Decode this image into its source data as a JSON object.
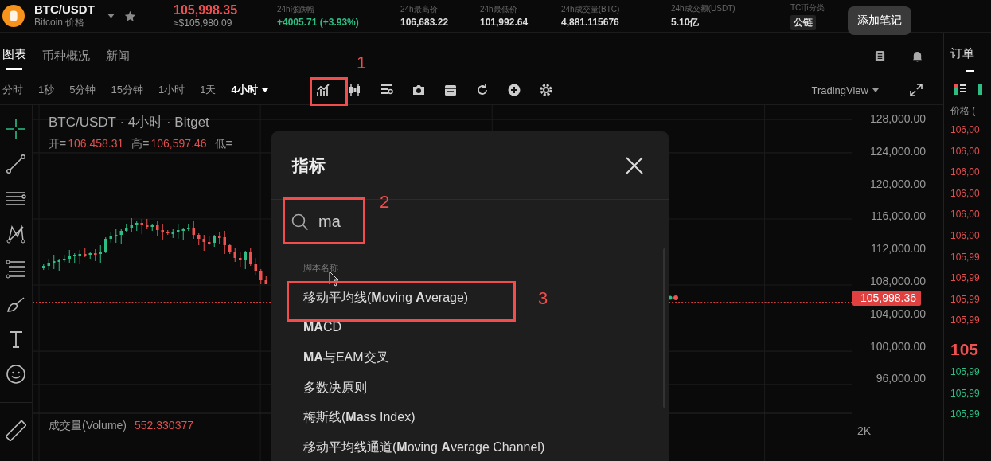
{
  "header": {
    "pair": "BTC/USDT",
    "subtitle": "Bitcoin 价格",
    "price": "105,998.35",
    "price_usd": "≈$105,980.09",
    "stats": [
      {
        "label": "24h涨跌幅",
        "value": "+4005.71 (+3.93%)",
        "kind": "up"
      },
      {
        "label": "24h最高价",
        "value": "106,683.22",
        "kind": "plain"
      },
      {
        "label": "24h最低价",
        "value": "101,992.64",
        "kind": "plain"
      },
      {
        "label": "24h成交量(BTC)",
        "value": "4,881.115676",
        "kind": "plain"
      },
      {
        "label": "24h成交额(USDT)",
        "value": "5.10亿",
        "kind": "plain"
      },
      {
        "label": "TC币分类",
        "value": "公链",
        "kind": "tag"
      }
    ]
  },
  "tooltip": "添加笔记",
  "tabs": [
    {
      "label": "图表",
      "selected": true
    },
    {
      "label": "币种概况",
      "selected": false
    },
    {
      "label": "新闻",
      "selected": false
    }
  ],
  "intervals": [
    {
      "label": "分时",
      "selected": false
    },
    {
      "label": "1秒",
      "selected": false
    },
    {
      "label": "5分钟",
      "selected": false
    },
    {
      "label": "15分钟",
      "selected": false
    },
    {
      "label": "1小时",
      "selected": false
    },
    {
      "label": "1天",
      "selected": false
    },
    {
      "label": "4小时",
      "selected": true
    }
  ],
  "chart_source": "TradingView",
  "chart": {
    "title": "BTC/USDT · 4小时 · Bitget",
    "ohlc": [
      {
        "label": "开=",
        "value": "106,458.31"
      },
      {
        "label": "高=",
        "value": "106,597.46"
      }
    ],
    "ohlc_more": "低=",
    "price_ticks": [
      "128,000.00",
      "124,000.00",
      "120,000.00",
      "116,000.00",
      "112,000.00",
      "108,000.00",
      "104,000.00",
      "100,000.00",
      "96,000.00"
    ],
    "current_price": "105,998.36",
    "volume_label": "成交量(Volume)",
    "volume_value": "552.330377",
    "volume_tick": "2K"
  },
  "dialog": {
    "title": "指标",
    "search": {
      "value": "ma"
    },
    "section": "脚本名称",
    "results": [
      "移动平均线(**M**oving **A**verage)",
      "**MA**CD",
      "**MA**与EAM交叉",
      "多数决原则",
      "梅斯线(**Ma**ss Index)",
      "移动平均线通道(**M**oving **A**verage Channel)"
    ]
  },
  "order_book": {
    "title": "订单",
    "header": "价格 (",
    "asks": [
      {
        "price": "106,00",
        "color": "#e0504f"
      },
      {
        "price": "106,00",
        "color": "#e0504f"
      },
      {
        "price": "106,00",
        "color": "#e0504f"
      },
      {
        "price": "106,00",
        "color": "#e0504f"
      },
      {
        "price": "106,00",
        "color": "#e0504f"
      },
      {
        "price": "106,00",
        "color": "#e0504f"
      },
      {
        "price": "105,99",
        "color": "#e0504f"
      },
      {
        "price": "105,99",
        "color": "#e0504f"
      },
      {
        "price": "105,99",
        "color": "#e0504f"
      },
      {
        "price": "105,99",
        "color": "#e0504f"
      }
    ],
    "last_price": "105",
    "bids": [
      {
        "price": "105,99",
        "color": "#2ebd85"
      },
      {
        "price": "105,99",
        "color": "#2ebd85"
      },
      {
        "price": "105,99",
        "color": "#2ebd85"
      }
    ]
  },
  "annotations": [
    {
      "label": "1"
    },
    {
      "label": "2"
    },
    {
      "label": "3"
    }
  ]
}
